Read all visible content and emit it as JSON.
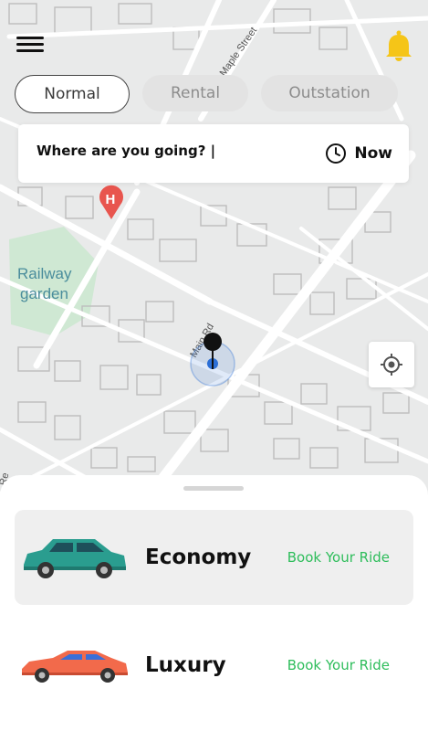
{
  "map": {
    "street_labels": [
      "Maple Street",
      "Main Rd"
    ],
    "poi_label_line1": "Railway",
    "poi_label_line2": "garden",
    "hospital_marker_letter": "H",
    "edge_label_left": "Re"
  },
  "topbar": {
    "menu_icon": "hamburger-menu-icon",
    "bell_icon": "bell-icon",
    "bell_color": "#f5c518"
  },
  "tabs": [
    {
      "label": "Normal",
      "active": true
    },
    {
      "label": "Rental",
      "active": false
    },
    {
      "label": "Outstation",
      "active": false
    }
  ],
  "search": {
    "value": "Where are you going? |",
    "time_label": "Now",
    "time_icon": "clock-icon"
  },
  "location_button_icon": "crosshair-icon",
  "rides": [
    {
      "name": "Economy",
      "action": "Book Your Ride",
      "car_color": "#2a9d8f",
      "selected": true
    },
    {
      "name": "Luxury",
      "action": "Book Your Ride",
      "car_color": "#f26a4b",
      "selected": false
    }
  ],
  "colors": {
    "accent_green": "#2ebd5b",
    "marker_blue": "#2c6fd6"
  }
}
